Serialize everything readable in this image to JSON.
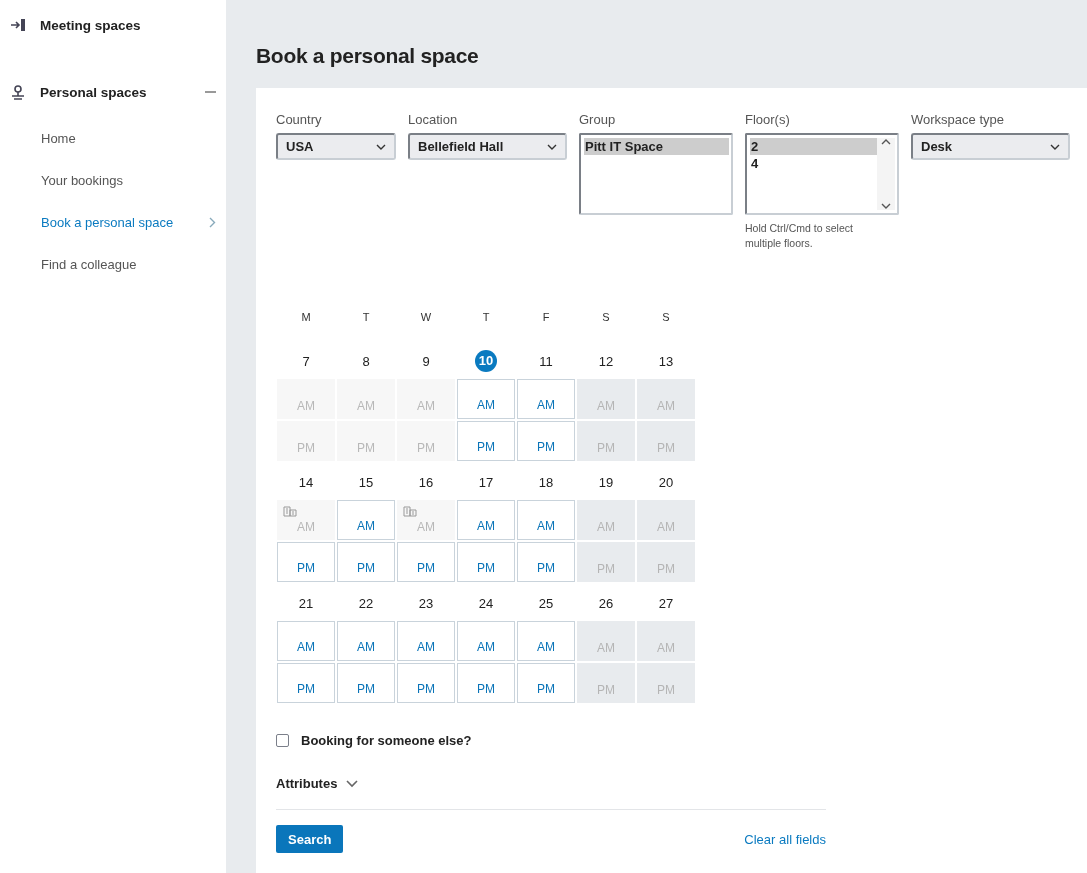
{
  "sidebar": {
    "sections": [
      {
        "label": "Meeting spaces",
        "expanded": false
      },
      {
        "label": "Personal spaces",
        "expanded": true,
        "items": [
          {
            "label": "Home",
            "selected": false
          },
          {
            "label": "Your bookings",
            "selected": false
          },
          {
            "label": "Book a personal space",
            "selected": true
          },
          {
            "label": "Find a colleague",
            "selected": false
          }
        ]
      }
    ]
  },
  "page": {
    "title": "Book a personal space"
  },
  "filters": [
    {
      "kind": "dropdown",
      "label": "Country",
      "value": "USA"
    },
    {
      "kind": "dropdown",
      "label": "Location",
      "value": "Bellefield Hall"
    },
    {
      "kind": "listbox",
      "label": "Group",
      "scrollbar": false,
      "options": [
        {
          "label": "Pitt IT Space",
          "selected": true
        }
      ]
    },
    {
      "kind": "listbox",
      "label": "Floor(s)",
      "scrollbar": true,
      "hint": "Hold Ctrl/Cmd to select multiple floors.",
      "options": [
        {
          "label": "2",
          "selected": true
        },
        {
          "label": "4",
          "selected": false
        }
      ]
    },
    {
      "kind": "dropdown",
      "label": "Workspace type",
      "value": "Desk"
    }
  ],
  "calendar": {
    "weekdays": [
      "M",
      "T",
      "W",
      "T",
      "F",
      "S",
      "S"
    ],
    "weeks": [
      {
        "days": [
          {
            "date": "7",
            "today": false,
            "am": {
              "label": "AM",
              "kind": "past",
              "flagged": false
            },
            "pm": {
              "label": "PM",
              "kind": "past",
              "flagged": false
            }
          },
          {
            "date": "8",
            "today": false,
            "am": {
              "label": "AM",
              "kind": "past",
              "flagged": false
            },
            "pm": {
              "label": "PM",
              "kind": "past",
              "flagged": false
            }
          },
          {
            "date": "9",
            "today": false,
            "am": {
              "label": "AM",
              "kind": "past",
              "flagged": false
            },
            "pm": {
              "label": "PM",
              "kind": "past",
              "flagged": false
            }
          },
          {
            "date": "10",
            "today": true,
            "am": {
              "label": "AM",
              "kind": "available",
              "flagged": false
            },
            "pm": {
              "label": "PM",
              "kind": "available",
              "flagged": false
            }
          },
          {
            "date": "11",
            "today": false,
            "am": {
              "label": "AM",
              "kind": "available",
              "flagged": false
            },
            "pm": {
              "label": "PM",
              "kind": "available",
              "flagged": false
            }
          },
          {
            "date": "12",
            "today": false,
            "am": {
              "label": "AM",
              "kind": "weekend",
              "flagged": false
            },
            "pm": {
              "label": "PM",
              "kind": "weekend",
              "flagged": false
            }
          },
          {
            "date": "13",
            "today": false,
            "am": {
              "label": "AM",
              "kind": "weekend",
              "flagged": false
            },
            "pm": {
              "label": "PM",
              "kind": "weekend",
              "flagged": false
            }
          }
        ]
      },
      {
        "days": [
          {
            "date": "14",
            "today": false,
            "am": {
              "label": "AM",
              "kind": "past",
              "flagged": true
            },
            "pm": {
              "label": "PM",
              "kind": "available",
              "flagged": false
            }
          },
          {
            "date": "15",
            "today": false,
            "am": {
              "label": "AM",
              "kind": "available",
              "flagged": false
            },
            "pm": {
              "label": "PM",
              "kind": "available",
              "flagged": false
            }
          },
          {
            "date": "16",
            "today": false,
            "am": {
              "label": "AM",
              "kind": "past",
              "flagged": true
            },
            "pm": {
              "label": "PM",
              "kind": "available",
              "flagged": false
            }
          },
          {
            "date": "17",
            "today": false,
            "am": {
              "label": "AM",
              "kind": "available",
              "flagged": false
            },
            "pm": {
              "label": "PM",
              "kind": "available",
              "flagged": false
            }
          },
          {
            "date": "18",
            "today": false,
            "am": {
              "label": "AM",
              "kind": "available",
              "flagged": false
            },
            "pm": {
              "label": "PM",
              "kind": "available",
              "flagged": false
            }
          },
          {
            "date": "19",
            "today": false,
            "am": {
              "label": "AM",
              "kind": "weekend",
              "flagged": false
            },
            "pm": {
              "label": "PM",
              "kind": "weekend",
              "flagged": false
            }
          },
          {
            "date": "20",
            "today": false,
            "am": {
              "label": "AM",
              "kind": "weekend",
              "flagged": false
            },
            "pm": {
              "label": "PM",
              "kind": "weekend",
              "flagged": false
            }
          }
        ]
      },
      {
        "days": [
          {
            "date": "21",
            "today": false,
            "am": {
              "label": "AM",
              "kind": "available",
              "flagged": false
            },
            "pm": {
              "label": "PM",
              "kind": "available",
              "flagged": false
            }
          },
          {
            "date": "22",
            "today": false,
            "am": {
              "label": "AM",
              "kind": "available",
              "flagged": false
            },
            "pm": {
              "label": "PM",
              "kind": "available",
              "flagged": false
            }
          },
          {
            "date": "23",
            "today": false,
            "am": {
              "label": "AM",
              "kind": "available",
              "flagged": false
            },
            "pm": {
              "label": "PM",
              "kind": "available",
              "flagged": false
            }
          },
          {
            "date": "24",
            "today": false,
            "am": {
              "label": "AM",
              "kind": "available",
              "flagged": false
            },
            "pm": {
              "label": "PM",
              "kind": "available",
              "flagged": false
            }
          },
          {
            "date": "25",
            "today": false,
            "am": {
              "label": "AM",
              "kind": "available",
              "flagged": false
            },
            "pm": {
              "label": "PM",
              "kind": "available",
              "flagged": false
            }
          },
          {
            "date": "26",
            "today": false,
            "am": {
              "label": "AM",
              "kind": "weekend",
              "flagged": false
            },
            "pm": {
              "label": "PM",
              "kind": "weekend",
              "flagged": false
            }
          },
          {
            "date": "27",
            "today": false,
            "am": {
              "label": "AM",
              "kind": "weekend",
              "flagged": false
            },
            "pm": {
              "label": "PM",
              "kind": "weekend",
              "flagged": false
            }
          }
        ]
      }
    ]
  },
  "someone_else": {
    "label": "Booking for someone else?",
    "checked": false
  },
  "attributes": {
    "label": "Attributes",
    "expanded": false
  },
  "actions": {
    "search": "Search",
    "clear": "Clear all fields"
  }
}
